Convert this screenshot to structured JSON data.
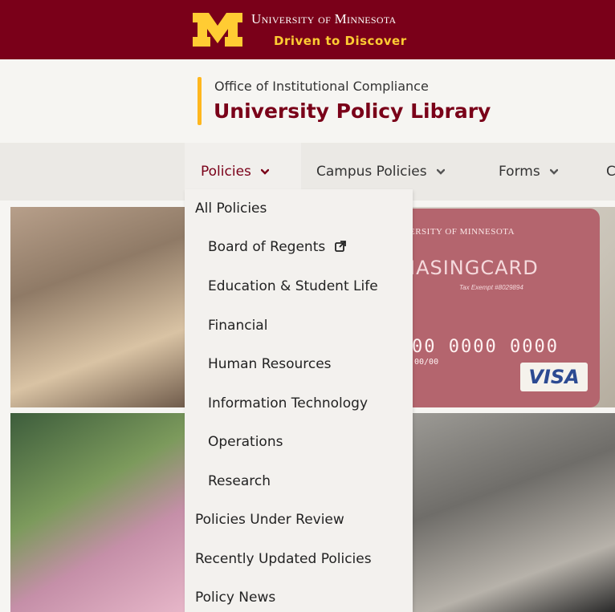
{
  "brand": {
    "university_name": "University of Minnesota",
    "tagline": "Driven to Discover",
    "colors": {
      "maroon": "#7a0019",
      "gold": "#ffcc33",
      "accent": "#ffb71e"
    }
  },
  "header": {
    "office": "Office of Institutional Compliance",
    "library": "University Policy Library"
  },
  "nav": {
    "items": [
      {
        "label": "Policies",
        "icon": "chevron-down-icon",
        "expanded": true
      },
      {
        "label": "Campus Policies",
        "icon": "chevron-down-icon"
      },
      {
        "label": "Forms",
        "icon": "chevron-down-icon"
      },
      {
        "label": "C"
      }
    ]
  },
  "dropdown": {
    "items": [
      {
        "label": "All Policies",
        "indent": false
      },
      {
        "label": "Board of Regents",
        "indent": true,
        "icon": "external-link-icon"
      },
      {
        "label": "Education & Student Life",
        "indent": true
      },
      {
        "label": "Financial",
        "indent": true
      },
      {
        "label": "Human Resources",
        "indent": true
      },
      {
        "label": "Information Technology",
        "indent": true
      },
      {
        "label": "Operations",
        "indent": true
      },
      {
        "label": "Research",
        "indent": true
      },
      {
        "label": "Policies Under Review",
        "indent": false
      },
      {
        "label": "Recently Updated Policies",
        "indent": false
      },
      {
        "label": "Policy News",
        "indent": false
      }
    ]
  },
  "hero": {
    "card": {
      "university": "ERSITY OF MINNESOTA",
      "title": "IASINGCARD",
      "tax": "Tax Exempt #8029894",
      "number": "00 0000 0000",
      "expiry": "00/00",
      "network": "VISA"
    }
  }
}
